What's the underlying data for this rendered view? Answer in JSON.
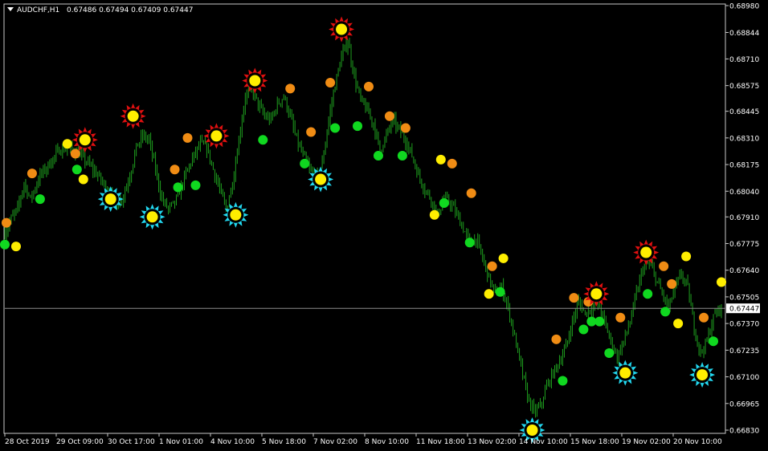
{
  "symbol_header": {
    "symbol": "AUDCHF,H1",
    "ohlc": "0.67486 0.67494 0.67409 0.67447"
  },
  "colors": {
    "background": "#000000",
    "frame": "#c8c8c8",
    "candles": "#1e9e1e",
    "bid_line": "#8c8c8c",
    "price_tag_bg": "#ffffff",
    "price_tag_text": "#000000",
    "red_star": "#e01010",
    "cyan_star": "#22d8f0",
    "yellow_dot": "#ffee00",
    "orange_dot": "#f08c14",
    "green_dot": "#10d820",
    "text": "#ffffff"
  },
  "chart_data": {
    "type": "line",
    "title": "AUDCHF,H1",
    "ylim": [
      0.6683,
      0.6898
    ],
    "y_ticks": [
      "0.68980",
      "0.68844",
      "0.68710",
      "0.68575",
      "0.68445",
      "0.68310",
      "0.68175",
      "0.68040",
      "0.67910",
      "0.67775",
      "0.67640",
      "0.67505",
      "0.67370",
      "0.67235",
      "0.67100",
      "0.66965",
      "0.66830"
    ],
    "x_ticks": [
      "28 Oct 2019",
      "29 Oct 09:00",
      "30 Oct 17:00",
      "1 Nov 01:00",
      "4 Nov 10:00",
      "5 Nov 18:00",
      "7 Nov 02:00",
      "8 Nov 10:00",
      "11 Nov 18:00",
      "13 Nov 02:00",
      "14 Nov 10:00",
      "15 Nov 18:00",
      "19 Nov 02:00",
      "20 Nov 10:00"
    ],
    "current_price": "0.67447",
    "price_path": [
      {
        "t": 0,
        "p": 0.6783
      },
      {
        "t": 4,
        "p": 0.679
      },
      {
        "t": 8,
        "p": 0.6795
      },
      {
        "t": 12,
        "p": 0.6808
      },
      {
        "t": 16,
        "p": 0.68
      },
      {
        "t": 22,
        "p": 0.6812
      },
      {
        "t": 28,
        "p": 0.6818
      },
      {
        "t": 34,
        "p": 0.6825
      },
      {
        "t": 40,
        "p": 0.6826
      },
      {
        "t": 46,
        "p": 0.6823
      },
      {
        "t": 52,
        "p": 0.6818
      },
      {
        "t": 58,
        "p": 0.6812
      },
      {
        "t": 64,
        "p": 0.6805
      },
      {
        "t": 70,
        "p": 0.6797
      },
      {
        "t": 74,
        "p": 0.6802
      },
      {
        "t": 78,
        "p": 0.6812
      },
      {
        "t": 82,
        "p": 0.6826
      },
      {
        "t": 86,
        "p": 0.6832
      },
      {
        "t": 90,
        "p": 0.683
      },
      {
        "t": 94,
        "p": 0.6815
      },
      {
        "t": 98,
        "p": 0.68
      },
      {
        "t": 102,
        "p": 0.6795
      },
      {
        "t": 106,
        "p": 0.6798
      },
      {
        "t": 110,
        "p": 0.6806
      },
      {
        "t": 114,
        "p": 0.6815
      },
      {
        "t": 118,
        "p": 0.6822
      },
      {
        "t": 122,
        "p": 0.6828
      },
      {
        "t": 126,
        "p": 0.6826
      },
      {
        "t": 130,
        "p": 0.6815
      },
      {
        "t": 134,
        "p": 0.6805
      },
      {
        "t": 138,
        "p": 0.6795
      },
      {
        "t": 142,
        "p": 0.6808
      },
      {
        "t": 146,
        "p": 0.683
      },
      {
        "t": 150,
        "p": 0.6852
      },
      {
        "t": 154,
        "p": 0.6856
      },
      {
        "t": 158,
        "p": 0.6848
      },
      {
        "t": 162,
        "p": 0.6842
      },
      {
        "t": 166,
        "p": 0.684
      },
      {
        "t": 170,
        "p": 0.6848
      },
      {
        "t": 174,
        "p": 0.6852
      },
      {
        "t": 178,
        "p": 0.6842
      },
      {
        "t": 182,
        "p": 0.683
      },
      {
        "t": 186,
        "p": 0.6822
      },
      {
        "t": 190,
        "p": 0.6815
      },
      {
        "t": 194,
        "p": 0.681
      },
      {
        "t": 198,
        "p": 0.6818
      },
      {
        "t": 202,
        "p": 0.684
      },
      {
        "t": 206,
        "p": 0.6858
      },
      {
        "t": 210,
        "p": 0.6872
      },
      {
        "t": 214,
        "p": 0.688
      },
      {
        "t": 218,
        "p": 0.6862
      },
      {
        "t": 222,
        "p": 0.685
      },
      {
        "t": 226,
        "p": 0.6845
      },
      {
        "t": 230,
        "p": 0.6838
      },
      {
        "t": 234,
        "p": 0.6825
      },
      {
        "t": 238,
        "p": 0.6832
      },
      {
        "t": 242,
        "p": 0.684
      },
      {
        "t": 246,
        "p": 0.6835
      },
      {
        "t": 250,
        "p": 0.683
      },
      {
        "t": 254,
        "p": 0.6822
      },
      {
        "t": 258,
        "p": 0.6812
      },
      {
        "t": 262,
        "p": 0.6805
      },
      {
        "t": 266,
        "p": 0.68
      },
      {
        "t": 270,
        "p": 0.6792
      },
      {
        "t": 274,
        "p": 0.68
      },
      {
        "t": 278,
        "p": 0.6798
      },
      {
        "t": 282,
        "p": 0.6792
      },
      {
        "t": 286,
        "p": 0.6785
      },
      {
        "t": 290,
        "p": 0.6778
      },
      {
        "t": 294,
        "p": 0.678
      },
      {
        "t": 298,
        "p": 0.677
      },
      {
        "t": 302,
        "p": 0.676
      },
      {
        "t": 306,
        "p": 0.6752
      },
      {
        "t": 310,
        "p": 0.6755
      },
      {
        "t": 314,
        "p": 0.6745
      },
      {
        "t": 318,
        "p": 0.673
      },
      {
        "t": 322,
        "p": 0.6715
      },
      {
        "t": 326,
        "p": 0.67
      },
      {
        "t": 330,
        "p": 0.6692
      },
      {
        "t": 334,
        "p": 0.6695
      },
      {
        "t": 338,
        "p": 0.6705
      },
      {
        "t": 342,
        "p": 0.6712
      },
      {
        "t": 346,
        "p": 0.6718
      },
      {
        "t": 350,
        "p": 0.6725
      },
      {
        "t": 354,
        "p": 0.6738
      },
      {
        "t": 358,
        "p": 0.6748
      },
      {
        "t": 362,
        "p": 0.6742
      },
      {
        "t": 366,
        "p": 0.6745
      },
      {
        "t": 370,
        "p": 0.6748
      },
      {
        "t": 374,
        "p": 0.6738
      },
      {
        "t": 378,
        "p": 0.6728
      },
      {
        "t": 382,
        "p": 0.672
      },
      {
        "t": 386,
        "p": 0.6728
      },
      {
        "t": 390,
        "p": 0.6738
      },
      {
        "t": 394,
        "p": 0.6752
      },
      {
        "t": 398,
        "p": 0.6765
      },
      {
        "t": 402,
        "p": 0.6768
      },
      {
        "t": 406,
        "p": 0.676
      },
      {
        "t": 410,
        "p": 0.6752
      },
      {
        "t": 414,
        "p": 0.6745
      },
      {
        "t": 418,
        "p": 0.6755
      },
      {
        "t": 422,
        "p": 0.6762
      },
      {
        "t": 426,
        "p": 0.6755
      },
      {
        "t": 430,
        "p": 0.6735
      },
      {
        "t": 434,
        "p": 0.6722
      },
      {
        "t": 438,
        "p": 0.6728
      },
      {
        "t": 442,
        "p": 0.674
      },
      {
        "t": 446,
        "p": 0.6745
      }
    ],
    "markers": [
      {
        "type": "green",
        "t": 0,
        "p": 0.6777
      },
      {
        "type": "orange",
        "t": 1,
        "p": 0.6788
      },
      {
        "type": "yellow",
        "t": 7,
        "p": 0.6776
      },
      {
        "type": "orange",
        "t": 17,
        "p": 0.6813
      },
      {
        "type": "green",
        "t": 22,
        "p": 0.68
      },
      {
        "type": "yellow",
        "t": 39,
        "p": 0.6828
      },
      {
        "type": "orange",
        "t": 44,
        "p": 0.6823
      },
      {
        "type": "green",
        "t": 45,
        "p": 0.6815
      },
      {
        "type": "yellow",
        "t": 49,
        "p": 0.681
      },
      {
        "type": "red",
        "t": 50,
        "p": 0.683
      },
      {
        "type": "cyan",
        "t": 66,
        "p": 0.68
      },
      {
        "type": "red",
        "t": 80,
        "p": 0.6842
      },
      {
        "type": "cyan",
        "t": 92,
        "p": 0.6791
      },
      {
        "type": "orange",
        "t": 106,
        "p": 0.6815
      },
      {
        "type": "green",
        "t": 108,
        "p": 0.6806
      },
      {
        "type": "orange",
        "t": 114,
        "p": 0.6831
      },
      {
        "type": "green",
        "t": 119,
        "p": 0.6807
      },
      {
        "type": "red",
        "t": 132,
        "p": 0.6832
      },
      {
        "type": "cyan",
        "t": 144,
        "p": 0.6792
      },
      {
        "type": "red",
        "t": 156,
        "p": 0.686
      },
      {
        "type": "green",
        "t": 161,
        "p": 0.683
      },
      {
        "type": "orange",
        "t": 178,
        "p": 0.6856
      },
      {
        "type": "green",
        "t": 187,
        "p": 0.6818
      },
      {
        "type": "orange",
        "t": 191,
        "p": 0.6834
      },
      {
        "type": "cyan",
        "t": 197,
        "p": 0.681
      },
      {
        "type": "orange",
        "t": 203,
        "p": 0.6859
      },
      {
        "type": "green",
        "t": 206,
        "p": 0.6836
      },
      {
        "type": "red",
        "t": 210,
        "p": 0.6886
      },
      {
        "type": "green",
        "t": 220,
        "p": 0.6837
      },
      {
        "type": "orange",
        "t": 227,
        "p": 0.6857
      },
      {
        "type": "green",
        "t": 233,
        "p": 0.6822
      },
      {
        "type": "orange",
        "t": 240,
        "p": 0.6842
      },
      {
        "type": "green",
        "t": 248,
        "p": 0.6822
      },
      {
        "type": "orange",
        "t": 250,
        "p": 0.6836
      },
      {
        "type": "yellow",
        "t": 268,
        "p": 0.6792
      },
      {
        "type": "green",
        "t": 274,
        "p": 0.6798
      },
      {
        "type": "yellow",
        "t": 272,
        "p": 0.682
      },
      {
        "type": "orange",
        "t": 279,
        "p": 0.6818
      },
      {
        "type": "orange",
        "t": 291,
        "p": 0.6803
      },
      {
        "type": "green",
        "t": 290,
        "p": 0.6778
      },
      {
        "type": "orange",
        "t": 304,
        "p": 0.6766
      },
      {
        "type": "yellow",
        "t": 302,
        "p": 0.6752
      },
      {
        "type": "green",
        "t": 309,
        "p": 0.6753
      },
      {
        "type": "yellow",
        "t": 311,
        "p": 0.677
      },
      {
        "type": "cyan",
        "t": 329,
        "p": 0.6683
      },
      {
        "type": "green",
        "t": 348,
        "p": 0.6708
      },
      {
        "type": "orange",
        "t": 344,
        "p": 0.6729
      },
      {
        "type": "orange",
        "t": 355,
        "p": 0.675
      },
      {
        "type": "green",
        "t": 361,
        "p": 0.6734
      },
      {
        "type": "orange",
        "t": 364,
        "p": 0.6748
      },
      {
        "type": "green",
        "t": 366,
        "p": 0.6738
      },
      {
        "type": "green",
        "t": 371,
        "p": 0.6738
      },
      {
        "type": "red",
        "t": 369,
        "p": 0.6752
      },
      {
        "type": "orange",
        "t": 384,
        "p": 0.674
      },
      {
        "type": "green",
        "t": 377,
        "p": 0.6722
      },
      {
        "type": "cyan",
        "t": 387,
        "p": 0.6712
      },
      {
        "type": "red",
        "t": 400,
        "p": 0.6773
      },
      {
        "type": "green",
        "t": 401,
        "p": 0.6752
      },
      {
        "type": "orange",
        "t": 411,
        "p": 0.6766
      },
      {
        "type": "orange",
        "t": 416,
        "p": 0.6757
      },
      {
        "type": "green",
        "t": 412,
        "p": 0.6743
      },
      {
        "type": "yellow",
        "t": 420,
        "p": 0.6737
      },
      {
        "type": "yellow",
        "t": 425,
        "p": 0.6771
      },
      {
        "type": "orange",
        "t": 436,
        "p": 0.674
      },
      {
        "type": "green",
        "t": 442,
        "p": 0.6728
      },
      {
        "type": "cyan",
        "t": 435,
        "p": 0.6711
      },
      {
        "type": "yellow",
        "t": 447,
        "p": 0.6758
      }
    ]
  }
}
